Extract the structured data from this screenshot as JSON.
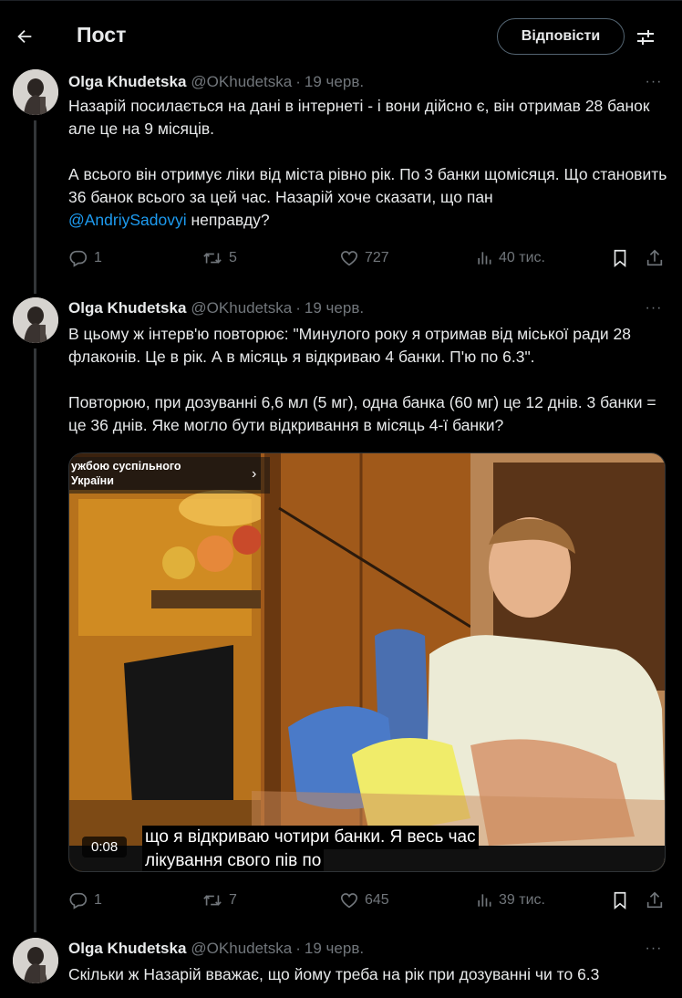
{
  "header": {
    "title": "Пост",
    "reply_label": "Відповісти",
    "icons": {
      "back": "arrow-left-icon",
      "settings": "sliders-icon"
    }
  },
  "tweets": [
    {
      "name": "Olga Khudetska",
      "handle": "@OKhudetska",
      "date": "19 черв.",
      "more": "···",
      "paragraphs": [
        "Назарій посилається на дані в інтернеті - і вони дійсно є, він отримав 28 банок але це на 9 місяців.",
        "А всього він отримує ліки від міста рівно рік. По 3 банки щомісяця. Що становить 36 банок всього за цей час.  Назарій хоче сказати, що пан"
      ],
      "mention": "@AndriySadovyi",
      "after_mention": " неправду?",
      "stats": {
        "replies": "1",
        "reposts": "5",
        "likes": "727",
        "views": "40 тис."
      }
    },
    {
      "name": "Olga Khudetska",
      "handle": "@OKhudetska",
      "date": "19 черв.",
      "more": "···",
      "paragraphs": [
        "В цьому ж інтерв'ю повторює: \"Минулого року я отримав від міської ради 28 флаконів. Це в рік. А в місяць я відкриваю 4 банки. П'ю по 6.3\".",
        "Повторюю, при дозуванні 6,6 мл (5 мг), одна банка (60 мг) це 12 днів. 3 банки = це 36 днів. Яке могло бути відкривання в місяць 4-ї банки?"
      ],
      "video": {
        "channel_line1": "ужбою суспільного",
        "channel_line2": "України",
        "channel_arrow": "›",
        "caption_line1": "що я відкриваю чотири банки. Я весь час",
        "caption_line2": "лікування свого пів по",
        "time": "0:08"
      },
      "stats": {
        "replies": "1",
        "reposts": "7",
        "likes": "645",
        "views": "39 тис."
      }
    },
    {
      "name": "Olga Khudetska",
      "handle": "@OKhudetska",
      "date": "19 черв.",
      "more": "···",
      "paragraphs": [
        "Скільки ж Назарій вважає, що йому треба на рік при дозуванні чи то 6.3"
      ]
    }
  ]
}
